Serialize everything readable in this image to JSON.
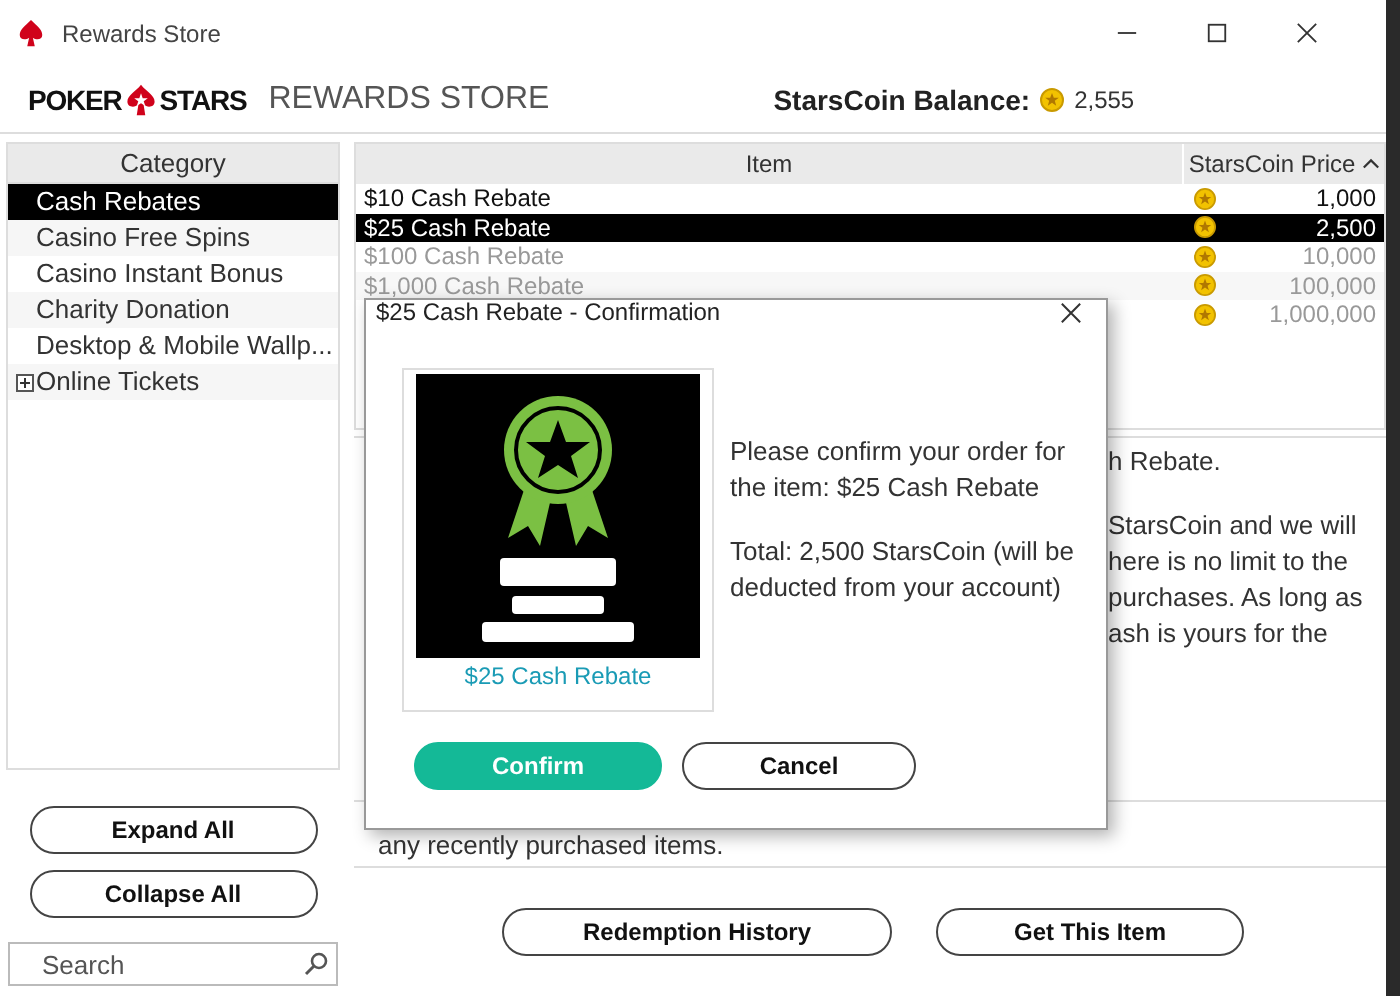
{
  "window": {
    "title": "Rewards Store"
  },
  "header": {
    "brand_left": "POKER",
    "brand_right": "STARS",
    "store_title": "REWARDS STORE",
    "balance_label": "StarsCoin Balance:",
    "balance": "2,555"
  },
  "categories": {
    "heading": "Category",
    "items": [
      {
        "label": "Cash Rebates",
        "kind": "leaf",
        "selected": true
      },
      {
        "label": "Casino Free Spins",
        "kind": "leaf",
        "selected": false
      },
      {
        "label": "Casino Instant Bonus",
        "kind": "leaf",
        "selected": false
      },
      {
        "label": "Charity Donation",
        "kind": "leaf",
        "selected": false
      },
      {
        "label": "Desktop & Mobile Wallp...",
        "kind": "leaf",
        "selected": false
      },
      {
        "label": "Online Tickets",
        "kind": "group",
        "selected": false
      }
    ]
  },
  "sidebar_buttons": [
    "Expand All",
    "Collapse All"
  ],
  "search": {
    "placeholder": "Search"
  },
  "table": {
    "columns": [
      "Item",
      "StarsCoin Price"
    ],
    "rows": [
      {
        "name": "$10 Cash Rebate",
        "price": "1,000",
        "selected": false,
        "disabled": false
      },
      {
        "name": "$25 Cash Rebate",
        "price": "2,500",
        "selected": true,
        "disabled": false
      },
      {
        "name": "$100 Cash Rebate",
        "price": "10,000",
        "selected": false,
        "disabled": true
      },
      {
        "name": "$1,000 Cash Rebate",
        "price": "100,000",
        "selected": false,
        "disabled": true
      },
      {
        "price": "1,000,000",
        "selected": false,
        "disabled": true
      }
    ]
  },
  "description": {
    "paragraphs": [
      [
        "h Rebate."
      ],
      [
        "StarsCoin and we will",
        "here is no limit to the",
        "purchases. As long as",
        "ash is yours for the"
      ]
    ],
    "bottom_line": "any recently purchased items."
  },
  "actions": [
    "Redemption History",
    "Get This Item"
  ],
  "dialog": {
    "title": "$25 Cash Rebate - Confirmation",
    "item_caption": "$25 Cash Rebate",
    "message": "Please confirm your order for the item: $25 Cash Rebate",
    "total": "Total: 2,500 StarsCoin (will be deducted from your account)",
    "confirm": "Confirm",
    "cancel": "Cancel"
  }
}
